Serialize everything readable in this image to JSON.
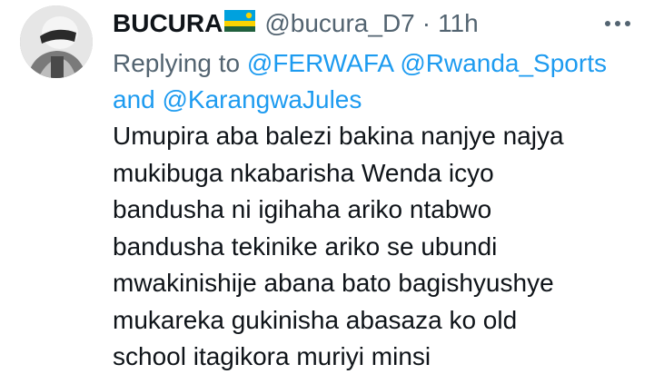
{
  "author": {
    "display_name": "BUCURA",
    "flag_icon": "rwanda-flag",
    "handle": "@bucura_D7",
    "separator": "·",
    "time": "11h"
  },
  "more_icon": "more-horizontal-icon",
  "reply": {
    "prefix": "Replying to",
    "mention_1": "@FERWAFA",
    "mention_2": "@Rwanda_Sports",
    "conjunction": "and",
    "mention_3": "@KarangwaJules"
  },
  "tweet": {
    "lines": [
      "Umupira aba balezi bakina nanjye najya",
      "mukibuga nkabarisha Wenda icyo",
      "bandusha ni igihaha ariko ntabwo",
      "bandusha tekinike ariko se ubundi",
      "mwakinishije abana bato bagishyushye",
      "mukareka gukinisha abasaza ko old",
      "school itagikora muriyi minsi"
    ]
  },
  "colors": {
    "text": "#0f1419",
    "secondary": "#536471",
    "link": "#1d9bf0",
    "flag_blue": "#20603d",
    "flag_sky": "#00a1de",
    "flag_yellow": "#fad201",
    "flag_green": "#20603d"
  }
}
